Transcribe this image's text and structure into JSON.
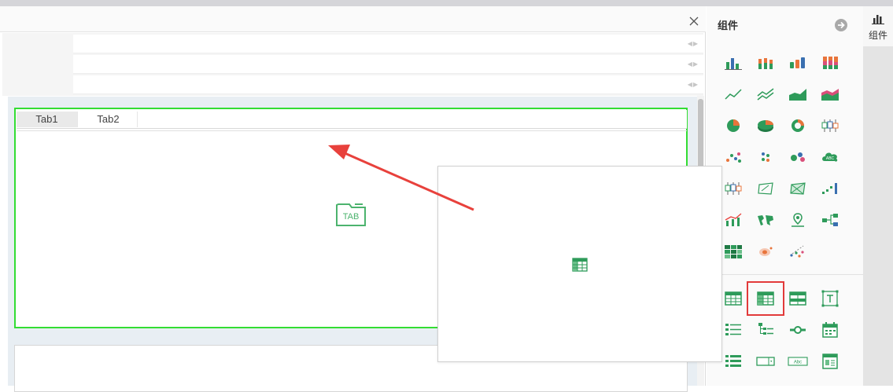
{
  "editor": {
    "close_icon": "close-icon",
    "dimension_rows": 3
  },
  "tab_widget": {
    "tabs": [
      {
        "label": "Tab1",
        "active": true
      },
      {
        "label": "Tab2",
        "active": false
      }
    ],
    "placeholder_icon": "tab-widget-icon",
    "placeholder_icon_text": "TAB",
    "border_color": "#33dd33"
  },
  "drag_preview": {
    "icon": "detail-table-icon"
  },
  "component_panel": {
    "title": "组件",
    "collapse_icon": "arrow-right-circle-icon",
    "chart_icons": [
      "column-chart-icon",
      "stacked-column-chart-icon",
      "range-column-chart-icon",
      "percent-stacked-column-chart-icon",
      "line-chart-icon",
      "multi-line-chart-icon",
      "area-chart-icon",
      "stacked-area-chart-icon",
      "pie-chart-icon",
      "3d-pie-chart-icon",
      "donut-chart-icon",
      "box-plot-icon",
      "scatter-chart-icon",
      "dot-plot-icon",
      "bubble-chart-icon",
      "word-cloud-icon",
      "box-plot-2-icon",
      "radar-chart-icon",
      "radar-area-chart-icon",
      "step-chart-icon",
      "combo-chart-icon",
      "map-icon",
      "point-map-icon",
      "funnel-flow-icon",
      "heatmap-icon",
      "heat-point-icon",
      "flow-map-icon"
    ],
    "widget_icons": [
      "cross-table-icon",
      "detail-table-icon",
      "grouped-table-icon",
      "text-box-icon",
      "list-filter-icon",
      "tree-filter-icon",
      "slider-filter-icon",
      "date-filter-icon",
      "list-icon",
      "dropdown-icon",
      "text-input-icon",
      "form-icon"
    ],
    "word_cloud_text": "ABC",
    "text_input_text": "Abc",
    "selected_icon": "detail-table-icon",
    "accent_color": "#2e9b5a",
    "highlight_color": "#e23a3a"
  },
  "side_tabs": {
    "label": "组件",
    "icon": "bar-chart-icon"
  },
  "annotation": {
    "arrow_color": "#e8413c"
  }
}
